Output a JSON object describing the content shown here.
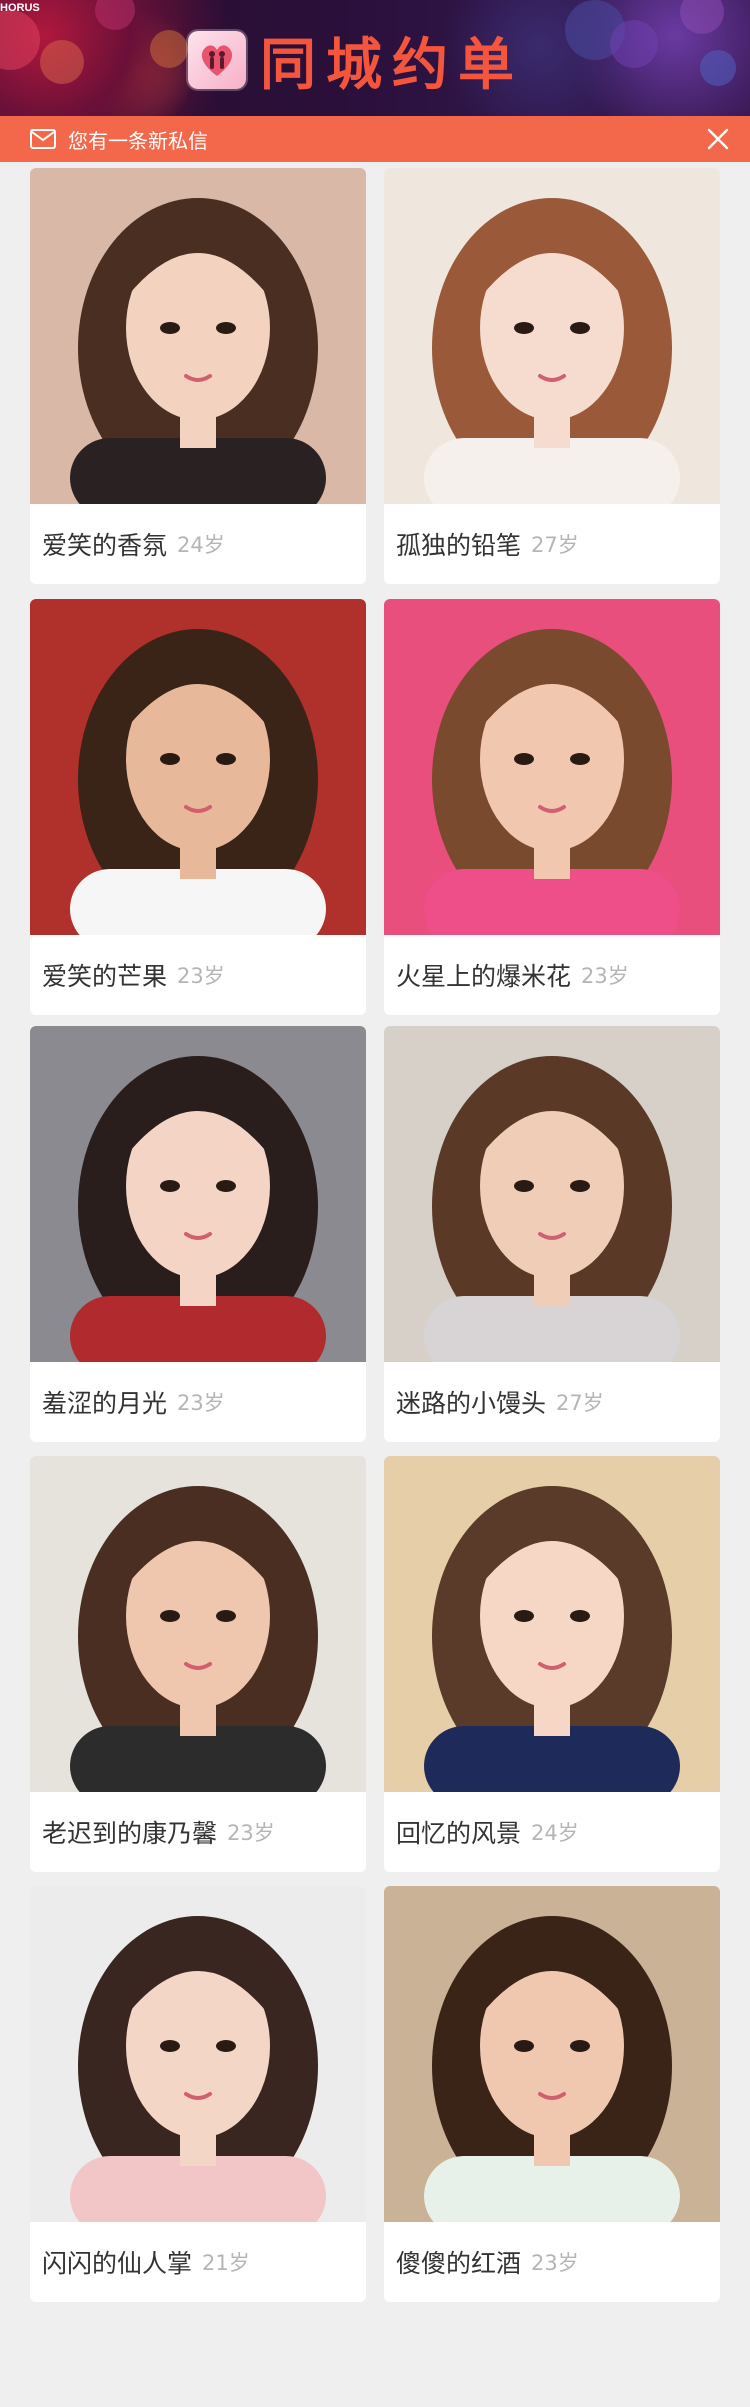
{
  "header": {
    "corner_logo": "HORUS",
    "title": "同城约单",
    "app_icon": "couple-heart-icon"
  },
  "notice": {
    "text": "您有一条新私信",
    "icon": "mail-icon",
    "close_icon": "close-icon"
  },
  "profiles": [
    {
      "name": "爱笑的香氛",
      "age": "24岁",
      "skin": "#f3d2c0",
      "hair": "#4a2e22",
      "bg": "#d9b8a8",
      "shirt": "#2a2222"
    },
    {
      "name": "孤独的铅笔",
      "age": "27岁",
      "skin": "#f6dccf",
      "hair": "#9a5a3a",
      "bg": "#efe6de",
      "shirt": "#f5f0ec"
    },
    {
      "name": "爱笑的芒果",
      "age": "23岁",
      "skin": "#e8b89a",
      "hair": "#3a2418",
      "bg": "#b0302c",
      "shirt": "#f6f6f6"
    },
    {
      "name": "火星上的爆米花",
      "age": "23岁",
      "skin": "#f2c7b0",
      "hair": "#7a4a2e",
      "bg": "#e84f7c",
      "shirt": "#ef4f88"
    },
    {
      "name": "羞涩的月光",
      "age": "23岁",
      "skin": "#f4d4c4",
      "hair": "#2a1e1c",
      "bg": "#8a8a90",
      "shirt": "#b02a2e"
    },
    {
      "name": "迷路的小馒头",
      "age": "27岁",
      "skin": "#f0cdb6",
      "hair": "#5a3a26",
      "bg": "#d7d0c8",
      "shirt": "#d8d4d6"
    },
    {
      "name": "老迟到的康乃馨",
      "age": "23岁",
      "skin": "#efc6ae",
      "hair": "#4a2e22",
      "bg": "#e6e2dc",
      "shirt": "#2c2c2c"
    },
    {
      "name": "回忆的风景",
      "age": "24岁",
      "skin": "#f6d6c4",
      "hair": "#5a3a28",
      "bg": "#e6cfa8",
      "shirt": "#1e2a5a"
    },
    {
      "name": "闪闪的仙人掌",
      "age": "21岁",
      "skin": "#f4d6c6",
      "hair": "#3a2620",
      "bg": "#ececec",
      "shirt": "#f2c6c6"
    },
    {
      "name": "傻傻的红酒",
      "age": "23岁",
      "skin": "#f0c8b0",
      "hair": "#3a2418",
      "bg": "#c9b296",
      "shirt": "#e8f0ea"
    }
  ]
}
